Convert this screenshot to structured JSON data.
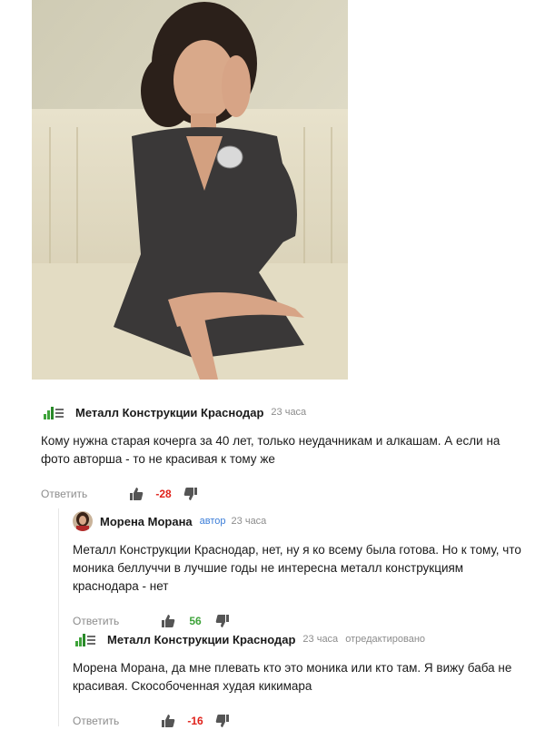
{
  "comments": [
    {
      "author": "Металл Конструкции Краснодар",
      "time": "23 часа",
      "text": "Кому нужна старая кочерга за 40 лет, только неудачникам и алкашам. А если на фото авторша - то не красивая к тому же",
      "reply_label": "Ответить",
      "score": "-28"
    },
    {
      "author": "Морена Морана",
      "author_tag": "автор",
      "time": "23 часа",
      "text": "Металл Конструкции Краснодар, нет, ну я ко всему была готова. Но к тому, что моника беллуччи в лучшие годы не интересна металл конструкциям краснодара - нет",
      "reply_label": "Ответить",
      "score": "56"
    },
    {
      "author": "Металл Конструкции Краснодар",
      "time": "23 часа",
      "edited": "отредактировано",
      "text": "Морена Морана, да мне плевать кто это моника или кто там. Я вижу баба не красивая. Скособоченная худая кикимара",
      "reply_label": "Ответить",
      "score": "-16"
    }
  ],
  "colors": {
    "negative": "#e0221b",
    "positive": "#3ea33a",
    "author_tag": "#3b7dd8",
    "muted": "#8c8c8c"
  },
  "icons": [
    "logo-icon",
    "thumbs-up-icon",
    "thumbs-down-icon"
  ]
}
